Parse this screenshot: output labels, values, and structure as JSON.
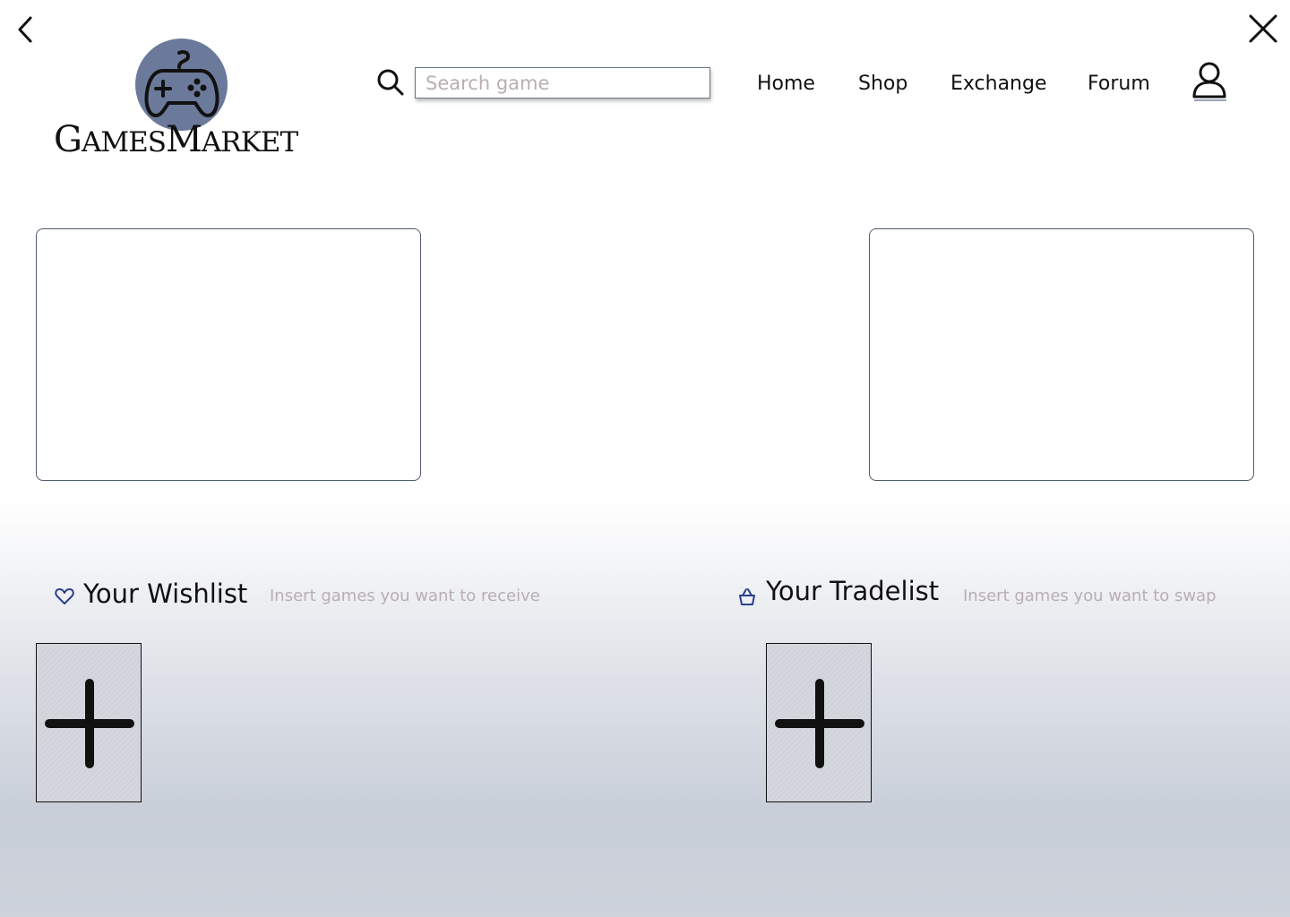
{
  "brand": {
    "name_first_big": "G",
    "name_first_rest": "AMES",
    "name_second_big": "M",
    "name_second_rest": "ARKET",
    "logo_circle_color": "#6b7a9a",
    "logo_icon": "gamepad-icon"
  },
  "window": {
    "back_icon": "chevron-left-icon",
    "close_icon": "close-icon"
  },
  "search": {
    "icon": "search-icon",
    "placeholder": "Search game",
    "value": ""
  },
  "nav": {
    "items": [
      {
        "label": "Home"
      },
      {
        "label": "Shop"
      },
      {
        "label": "Exchange"
      },
      {
        "label": "Forum"
      }
    ],
    "profile_icon": "user-icon"
  },
  "wishlist": {
    "icon": "heart-icon",
    "title": "Your Wishlist",
    "hint": "Insert games you want to receive",
    "add_icon": "plus-icon"
  },
  "tradelist": {
    "icon": "basket-icon",
    "title": "Your Tradelist",
    "hint": "Insert games you want to swap",
    "add_icon": "plus-icon"
  },
  "colors": {
    "accent": "#6b7a9a",
    "hint_text": "#b9aeb3",
    "panel_border": "#4f5a70",
    "icon_blue": "#2b3f8f"
  }
}
